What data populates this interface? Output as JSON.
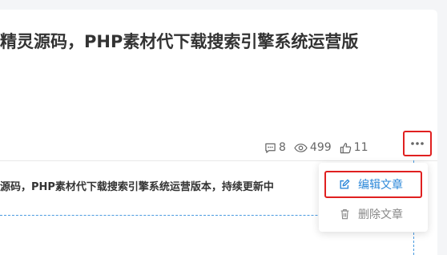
{
  "article": {
    "title": "精灵源码，PHP素材代下载搜索引擎系统运营版",
    "description": "源码，PHP素材代下载搜索引擎系统运营版本，持续更新中"
  },
  "stats": {
    "comments": "8",
    "views": "499",
    "likes": "11"
  },
  "menu": {
    "items": [
      {
        "label": "编辑文章",
        "icon": "edit-icon"
      },
      {
        "label": "删除文章",
        "icon": "trash-icon"
      }
    ]
  },
  "colors": {
    "accent": "#2c88d9",
    "highlight": "#e02020",
    "muted": "#888888"
  }
}
